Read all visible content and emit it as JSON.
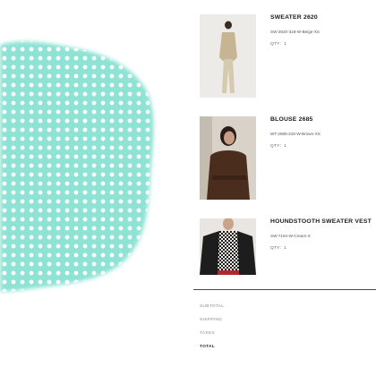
{
  "cart": {
    "items": [
      {
        "name": "SWEATER 2620",
        "sku": "SW-2620-318-W-Beige-XS",
        "qty_label": "QTY:",
        "qty": "1",
        "image": "model-beige-sweater-photo"
      },
      {
        "name": "BLOUSE 2685",
        "sku": "WT-2685-318-W-Brown-XS",
        "qty_label": "QTY:",
        "qty": "1",
        "image": "model-brown-blouse-photo"
      },
      {
        "name": "HOUNDSTOOTH SWEATER VEST",
        "sku": "SW-7194-W-Cream-S",
        "qty_label": "QTY:",
        "qty": "1",
        "image": "model-houndstooth-vest-photo"
      }
    ]
  },
  "summary": {
    "subtotal_label": "SUBTOTAL",
    "shipping_label": "SHIPPING",
    "taxes_label": "TAXES",
    "total_label": "TOTAL"
  },
  "colors": {
    "decoration_mint": "#8fe3d4",
    "divider": "#4a4a4a"
  }
}
